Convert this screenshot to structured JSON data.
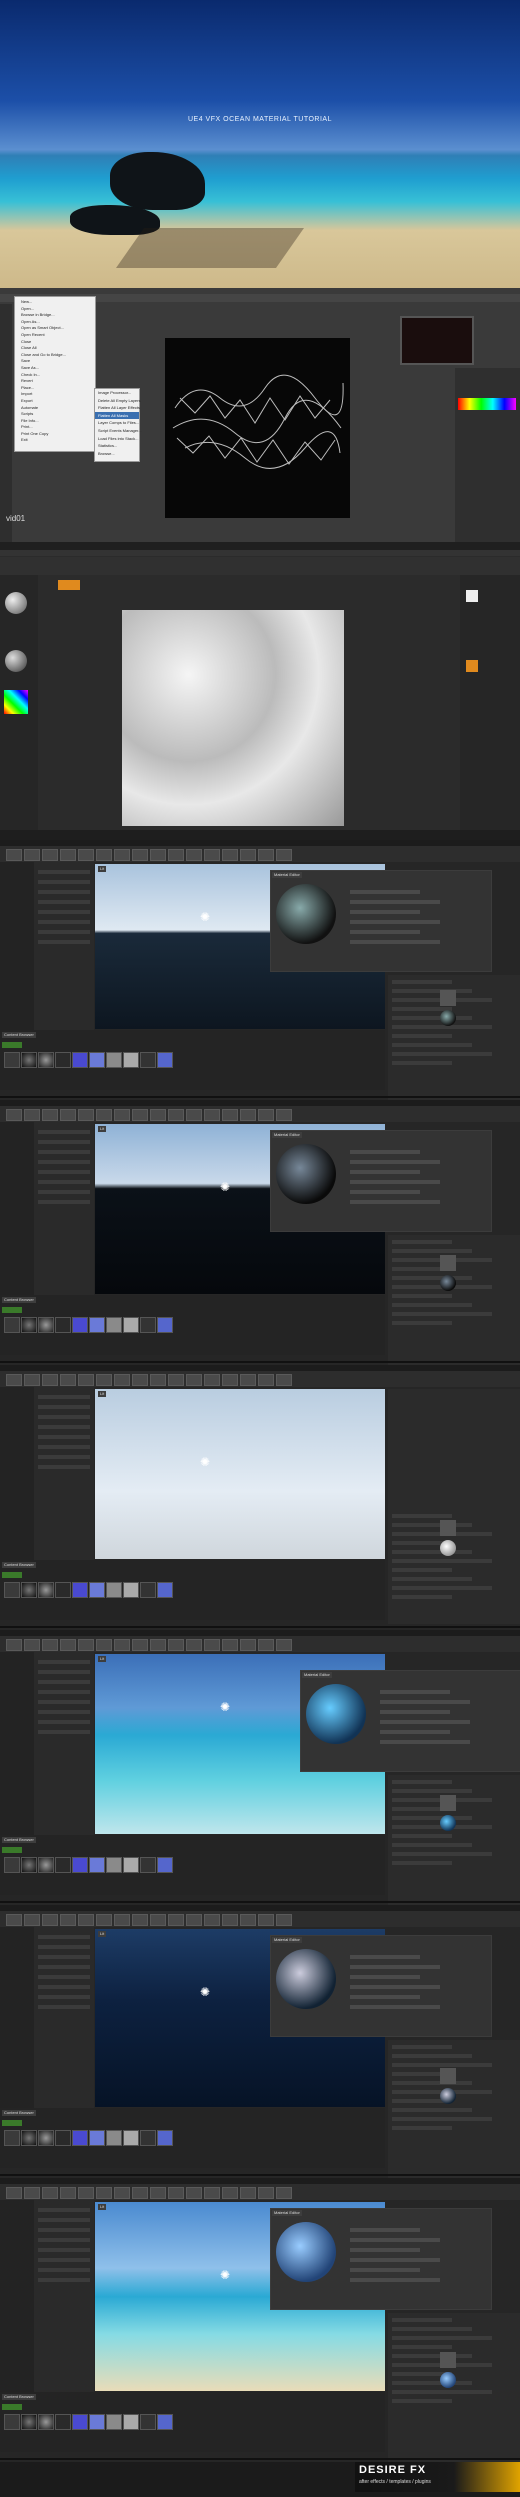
{
  "hero": {
    "title": "UE4 VFX OCEAN MATERIAL TUTORIAL"
  },
  "photoshop": {
    "file_menu": [
      "New...",
      "Open...",
      "Browse in Bridge...",
      "Open As...",
      "Open as Smart Object...",
      "Open Recent",
      "Close",
      "Close All",
      "Close and Go to Bridge...",
      "Save",
      "Save As...",
      "Check In...",
      "Revert",
      "Place...",
      "Import",
      "Export",
      "Automate",
      "Scripts",
      "File Info...",
      "Print...",
      "Print One Copy",
      "Exit"
    ],
    "submenu": [
      "Image Processor...",
      "Delete All Empty Layers",
      "Flatten All Layer Effects",
      "Flatten All Masks",
      "Layer Comps to Files...",
      "Script Events Manager...",
      "Load Files into Stack...",
      "Statistics...",
      "Browse..."
    ],
    "zoom_label": "vid01"
  },
  "ue_sections": [
    {
      "id": "s1",
      "tab": "Material Editor",
      "content_browser": "Content Browser",
      "mode": "Lit"
    },
    {
      "id": "s2",
      "tab": "Material Editor",
      "content_browser": "Content Browser",
      "mode": "Lit"
    },
    {
      "id": "s3",
      "tab": "Material Editor",
      "content_browser": "Content Browser",
      "mode": "Lit"
    },
    {
      "id": "s4",
      "tab": "Material Editor",
      "content_browser": "Content Browser",
      "mode": "Lit"
    },
    {
      "id": "s5",
      "tab": "Material Editor",
      "content_browser": "Content Browser",
      "mode": "Lit"
    },
    {
      "id": "s6",
      "tab": "Material Editor",
      "content_browser": "Content Browser",
      "mode": "Lit"
    }
  ],
  "watermark": {
    "brand": "DESIRE FX",
    "tagline": "after effects / templates / plugins"
  },
  "colors": {
    "accent_orange": "#e08a1e",
    "ue_blue": "#3a6fb0",
    "water": "#2aa9d4"
  }
}
